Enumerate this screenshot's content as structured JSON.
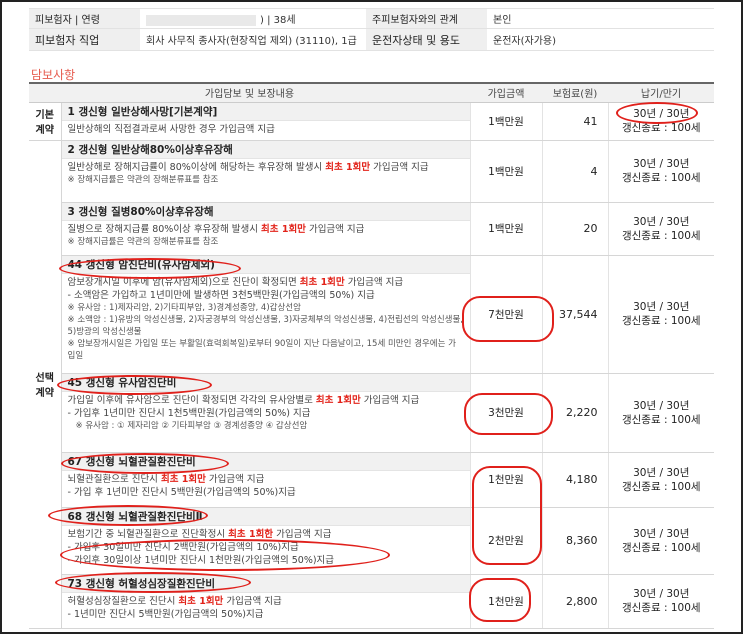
{
  "insured_info": {
    "row1": {
      "label_left": "피보험자 | 연령",
      "value_left_tail": ") | 38세",
      "label_right": "주피보험자와의 관계",
      "value_right": "본인"
    },
    "row2": {
      "label_left": "피보험자 직업",
      "value_left": "회사 사무직 종사자(현장직업 제외) (31110), 1급",
      "label_right": "운전자상태 및 용도",
      "value_right": "운전자(자가용)"
    }
  },
  "section_title": "담보사항",
  "table": {
    "headers": {
      "coverage": "가입담보 및 보장내용",
      "amount": "가입금액",
      "premium": "보험료(원)",
      "term": "납기/만기"
    },
    "categories": {
      "basic_line1": "기본",
      "basic_line2": "계약",
      "optional_line1": "선택",
      "optional_line2": "계약"
    },
    "rows": [
      {
        "title": "1  갱신형 일반상해사망[기본계약]",
        "desc_parts": [
          "일반상해의 직접결과로써 사망한 경우 가입금액 지급"
        ],
        "amount": "1백만원",
        "premium": "41",
        "term_line1": "30년 / 30년",
        "term_line2": "갱신종료 : 100세"
      },
      {
        "title": "2  갱신형 일반상해80%이상후유장해",
        "desc_parts": [
          "일반상해로 장해지급률이 80%이상에 해당하는 후유장해 발생시 ",
          "최초 1회만",
          " 가입금액 지급"
        ],
        "note": "※ 장해지급률은 약관의 장해분류표를 참조",
        "amount": "1백만원",
        "premium": "4",
        "term_line1": "30년 / 30년",
        "term_line2": "갱신종료 : 100세"
      },
      {
        "title": "3  갱신형 질병80%이상후유장해",
        "desc_parts": [
          "질병으로 장해지급률 80%이상 후유장해 발생시  ",
          "최초 1회만",
          " 가입금액 지급"
        ],
        "note": "※ 장해지급률은 약관의 장해분류표를 참조",
        "amount": "1백만원",
        "premium": "20",
        "term_line1": "30년 / 30년",
        "term_line2": "갱신종료 : 100세"
      },
      {
        "title": "44  갱신형 암진단비(유사암제외)",
        "desc_parts": [
          "암보장개시일 이후에 암(유사암제외)으로 진단이 확정되면 ",
          "최초 1회만",
          " 가입금액 지급"
        ],
        "desc_line2": "- 소액암은 가입하고 1년미만에 발생하면 3천5백만원(가입금액의 50%) 지급",
        "notes": [
          "※ 유사암 : 1)제자리암, 2)기타피부암, 3)경계성종양, 4)갑상선암",
          "※ 소액암 : 1)유방의 악성신생물, 2)자궁경부의 악성신생물, 3)자궁체부의 악성신생물, 4)전립선의 악성신생물, 5)방광의 악성신생물",
          "※ 암보장개시일은 가입일 또는 부활일(효력회복일)로부터 90일이 지난 다음날이고, 15세 미만인 경우에는 가입일"
        ],
        "amount": "7천만원",
        "premium": "37,544",
        "term_line1": "30년 / 30년",
        "term_line2": "갱신종료 : 100세"
      },
      {
        "title": "45  갱신형 유사암진단비",
        "desc_parts": [
          "가입일 이후에 유사암으로 진단이 확정되면 각각의 유사암별로 ",
          "최초 1회만",
          " 가입금액 지급"
        ],
        "desc_line2": "- 가입후 1년미만 진단시 1천5백만원(가입금액의 50%) 지급",
        "note": "※ 유사암 : ① 제자리암 ② 기타피부암 ③ 경계성종양 ④ 갑상선암",
        "amount": "3천만원",
        "premium": "2,220",
        "term_line1": "30년 / 30년",
        "term_line2": "갱신종료 : 100세"
      },
      {
        "title": "67  갱신형 뇌혈관질환진단비",
        "desc_parts": [
          "뇌혈관질환으로 진단시 ",
          "최초 1회만",
          " 가입금액 지급"
        ],
        "desc_line2": "- 가입 후 1년미만 진단시 5백만원(가입금액의 50%)지급",
        "amount": "1천만원",
        "premium": "4,180",
        "term_line1": "30년 / 30년",
        "term_line2": "갱신종료 : 100세"
      },
      {
        "title": "68  갱신형 뇌혈관질환진단비Ⅱ",
        "desc_parts": [
          "보험기간 중 뇌혈관질환으로 진단확정시 ",
          "최초 1회한",
          " 가입금액 지급"
        ],
        "desc_line2": "- 가입후 30일미만 진단시 2백만원(가입금액의 10%)지급",
        "desc_line3": "- 가입후 30일이상 1년미만 진단시 1천만원(가입금액의 50%)지급",
        "amount": "2천만원",
        "premium": "8,360",
        "term_line1": "30년 / 30년",
        "term_line2": "갱신종료 : 100세"
      },
      {
        "title": "73  갱신형 허혈성심장질환진단비",
        "desc_parts": [
          "허혈성심장질환으로 진단시 ",
          "최초 1회만",
          "  가입금액 지급"
        ],
        "desc_line2": "- 1년미만 진단시 5백만원(가입금액의 50%)지급",
        "amount": "1천만원",
        "premium": "2,800",
        "term_line1": "30년 / 30년",
        "term_line2": "갱신종료 : 100세"
      }
    ]
  },
  "colors": {
    "accent_red": "#e2231a",
    "section_title": "#e65a4d",
    "header_bg": "#f1f1f1"
  }
}
